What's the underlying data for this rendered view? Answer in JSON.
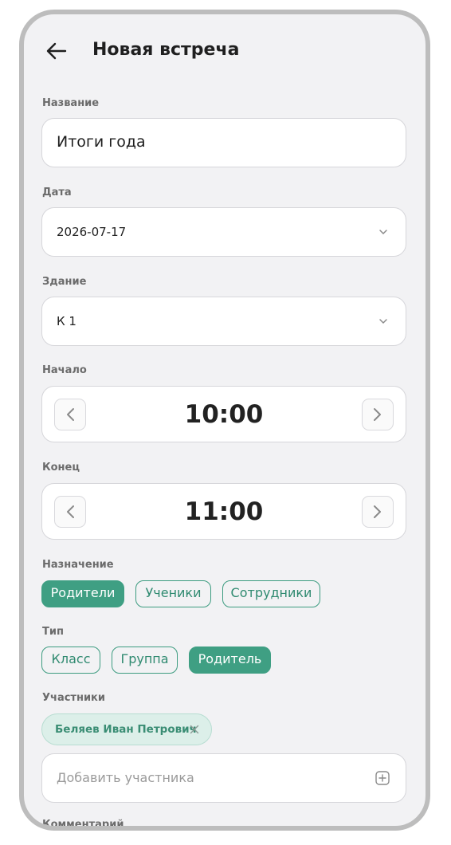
{
  "header": {
    "title": "Новая встреча"
  },
  "form": {
    "name": {
      "label": "Название",
      "value": "Итоги года"
    },
    "date": {
      "label": "Дата",
      "value": "2026-07-17"
    },
    "building": {
      "label": "Здание",
      "value": "К 1"
    },
    "start": {
      "label": "Начало",
      "value": "10:00"
    },
    "end": {
      "label": "Конец",
      "value": "11:00"
    },
    "purpose": {
      "label": "Назначение",
      "options": [
        "Родители",
        "Ученики",
        "Сотрудники"
      ],
      "selected": "Родители"
    },
    "type": {
      "label": "Тип",
      "options": [
        "Класс",
        "Группа",
        "Родитель"
      ],
      "selected": "Родитель"
    },
    "participants": {
      "label": "Участники",
      "items": [
        "Беляев Иван Петрович"
      ],
      "add_placeholder": "Добавить участника"
    },
    "comment": {
      "label": "Комментарий"
    }
  },
  "colors": {
    "accent": "#3f9f83",
    "accent_text": "#2f8a70",
    "background": "#f2f2f4",
    "chip_light": "#dcefe9"
  },
  "icons": {
    "back": "arrow-left-icon",
    "dropdown": "chevron-down-icon",
    "prev": "chevron-left-icon",
    "next": "chevron-right-icon",
    "remove": "close-icon",
    "add": "plus-square-icon"
  }
}
